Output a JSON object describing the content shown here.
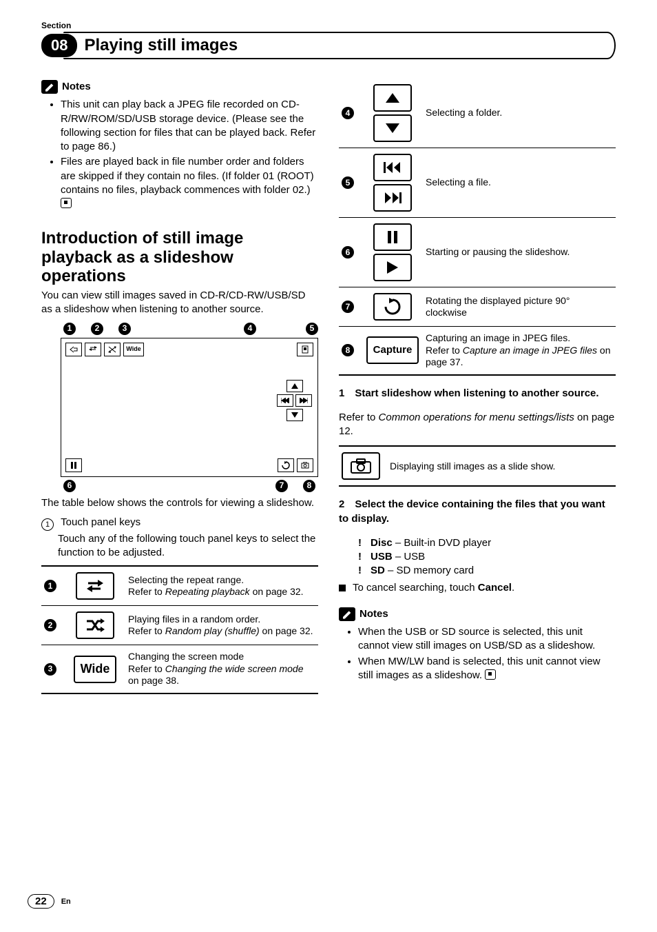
{
  "header": {
    "section_label": "Section",
    "chapter_number": "08",
    "chapter_title": "Playing still images"
  },
  "left": {
    "notes_label": "Notes",
    "notes": [
      "This unit can play back a JPEG file recorded on CD-R/RW/ROM/SD/USB storage device. (Please see the following section for files that can be played back. Refer to page 86.)",
      "Files are played back in file number order and folders are skipped if they contain no files. (If folder 01 (ROOT) contains no files, playback commences with folder 02.)"
    ],
    "h2": "Introduction of still image playback as a slideshow operations",
    "intro": "You can view still images saved in CD-R/CD-RW/USB/SD as a slideshow when listening to another source.",
    "table_intro": "The table below shows the controls for viewing a slideshow.",
    "touch_label": "Touch panel keys",
    "touch_desc": "Touch any of the following touch panel keys to select the function to be adjusted.",
    "controls": [
      {
        "n": "1",
        "icon": "repeat",
        "desc_a": "Selecting the repeat range.",
        "desc_b": "Refer to ",
        "ref": "Repeating playback",
        "tail": " on page 32."
      },
      {
        "n": "2",
        "icon": "shuffle",
        "desc_a": "Playing files in a random order.",
        "desc_b": "Refer to ",
        "ref": "Random play (shuffle)",
        "tail": " on page 32."
      },
      {
        "n": "3",
        "icon": "wide",
        "label": "Wide",
        "desc_a": "Changing the screen mode",
        "desc_b": "Refer to ",
        "ref": "Changing the wide screen mode",
        "tail": " on page 38."
      }
    ]
  },
  "right": {
    "controls": [
      {
        "n": "4",
        "icons": [
          "up",
          "down"
        ],
        "desc": "Selecting a folder."
      },
      {
        "n": "5",
        "icons": [
          "prev",
          "next"
        ],
        "desc": "Selecting a file."
      },
      {
        "n": "6",
        "icons": [
          "pause",
          "play"
        ],
        "desc": "Starting or pausing the slideshow."
      },
      {
        "n": "7",
        "icons": [
          "rotate"
        ],
        "desc": "Rotating the displayed picture 90° clockwise"
      },
      {
        "n": "8",
        "icons": [
          "capture"
        ],
        "label": "Capture",
        "desc_a": "Capturing an image in JPEG files.",
        "desc_b": "Refer to ",
        "ref": "Capture an image in JPEG files",
        "tail": " on page 37."
      }
    ],
    "step1_head": "1 Start slideshow when listening to another source.",
    "step1_body_a": "Refer to ",
    "step1_ref": "Common operations for menu settings/lists",
    "step1_body_b": " on page 12.",
    "step1_icon_desc": "Displaying still images as a slide show.",
    "step2_head": "2 Select the device containing the files that you want to display.",
    "devices": [
      {
        "b": "Disc",
        "t": " – Built-in DVD player"
      },
      {
        "b": "USB",
        "t": " – USB"
      },
      {
        "b": "SD",
        "t": " – SD memory card"
      }
    ],
    "cancel_a": "To cancel searching, touch ",
    "cancel_b": "Cancel",
    "cancel_c": ".",
    "notes_label": "Notes",
    "notes": [
      "When the USB or SD source is selected, this unit cannot view still images on USB/SD as a slideshow.",
      "When MW/LW band is selected, this unit cannot view still images as a slideshow."
    ]
  },
  "footer": {
    "page": "22",
    "lang": "En"
  }
}
